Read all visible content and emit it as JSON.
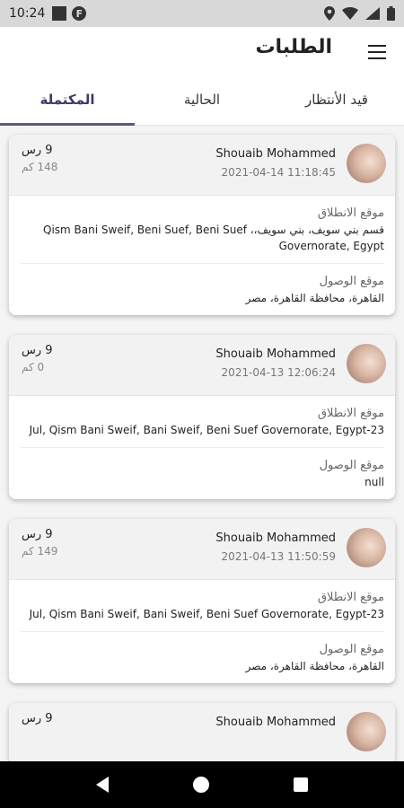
{
  "status": {
    "time": "10:24",
    "app_badge": "F"
  },
  "header": {
    "title": "الطلبات"
  },
  "tabs": [
    {
      "label": "قيد الأنتظار"
    },
    {
      "label": "الحالية"
    },
    {
      "label": "المكتملة"
    }
  ],
  "labels": {
    "pickup": "موقع الانطلاق",
    "dropoff": "موقع الوصول"
  },
  "orders": [
    {
      "name": "Shouaib Mohammed",
      "datetime": "2021-04-14 11:18:45",
      "price": "9 رس",
      "distance": "148 كم",
      "pickup": "قسم بني سويف، بني سويف،، Qism Bani Sweif, Beni Suef, Beni Suef Governorate, Egypt",
      "dropoff": "القاهرة، محافظة القاهرة، مصر"
    },
    {
      "name": "Shouaib Mohammed",
      "datetime": "2021-04-13 12:06:24",
      "price": "9 رس",
      "distance": "0 كم",
      "pickup": "23-Jul, Qism Bani Sweif, Bani Sweif, Beni Suef Governorate, Egypt",
      "dropoff": "null"
    },
    {
      "name": "Shouaib Mohammed",
      "datetime": "2021-04-13 11:50:59",
      "price": "9 رس",
      "distance": "149 كم",
      "pickup": "23-Jul, Qism Bani Sweif, Bani Sweif, Beni Suef Governorate, Egypt",
      "dropoff": "القاهرة، محافظة القاهرة، مصر"
    },
    {
      "name": "Shouaib Mohammed",
      "datetime": "",
      "price": "9 رس",
      "distance": "",
      "pickup": "",
      "dropoff": ""
    }
  ],
  "icons": {
    "menu": "hamburger-menu-icon",
    "location": "location-icon",
    "wifi": "wifi-icon",
    "signal": "signal-icon",
    "battery": "battery-icon"
  },
  "colors": {
    "accent": "#5a5a80",
    "active_tab_text": "#3b3a64",
    "status_bar": "#d8d8d8",
    "nav_bar": "#000000"
  }
}
